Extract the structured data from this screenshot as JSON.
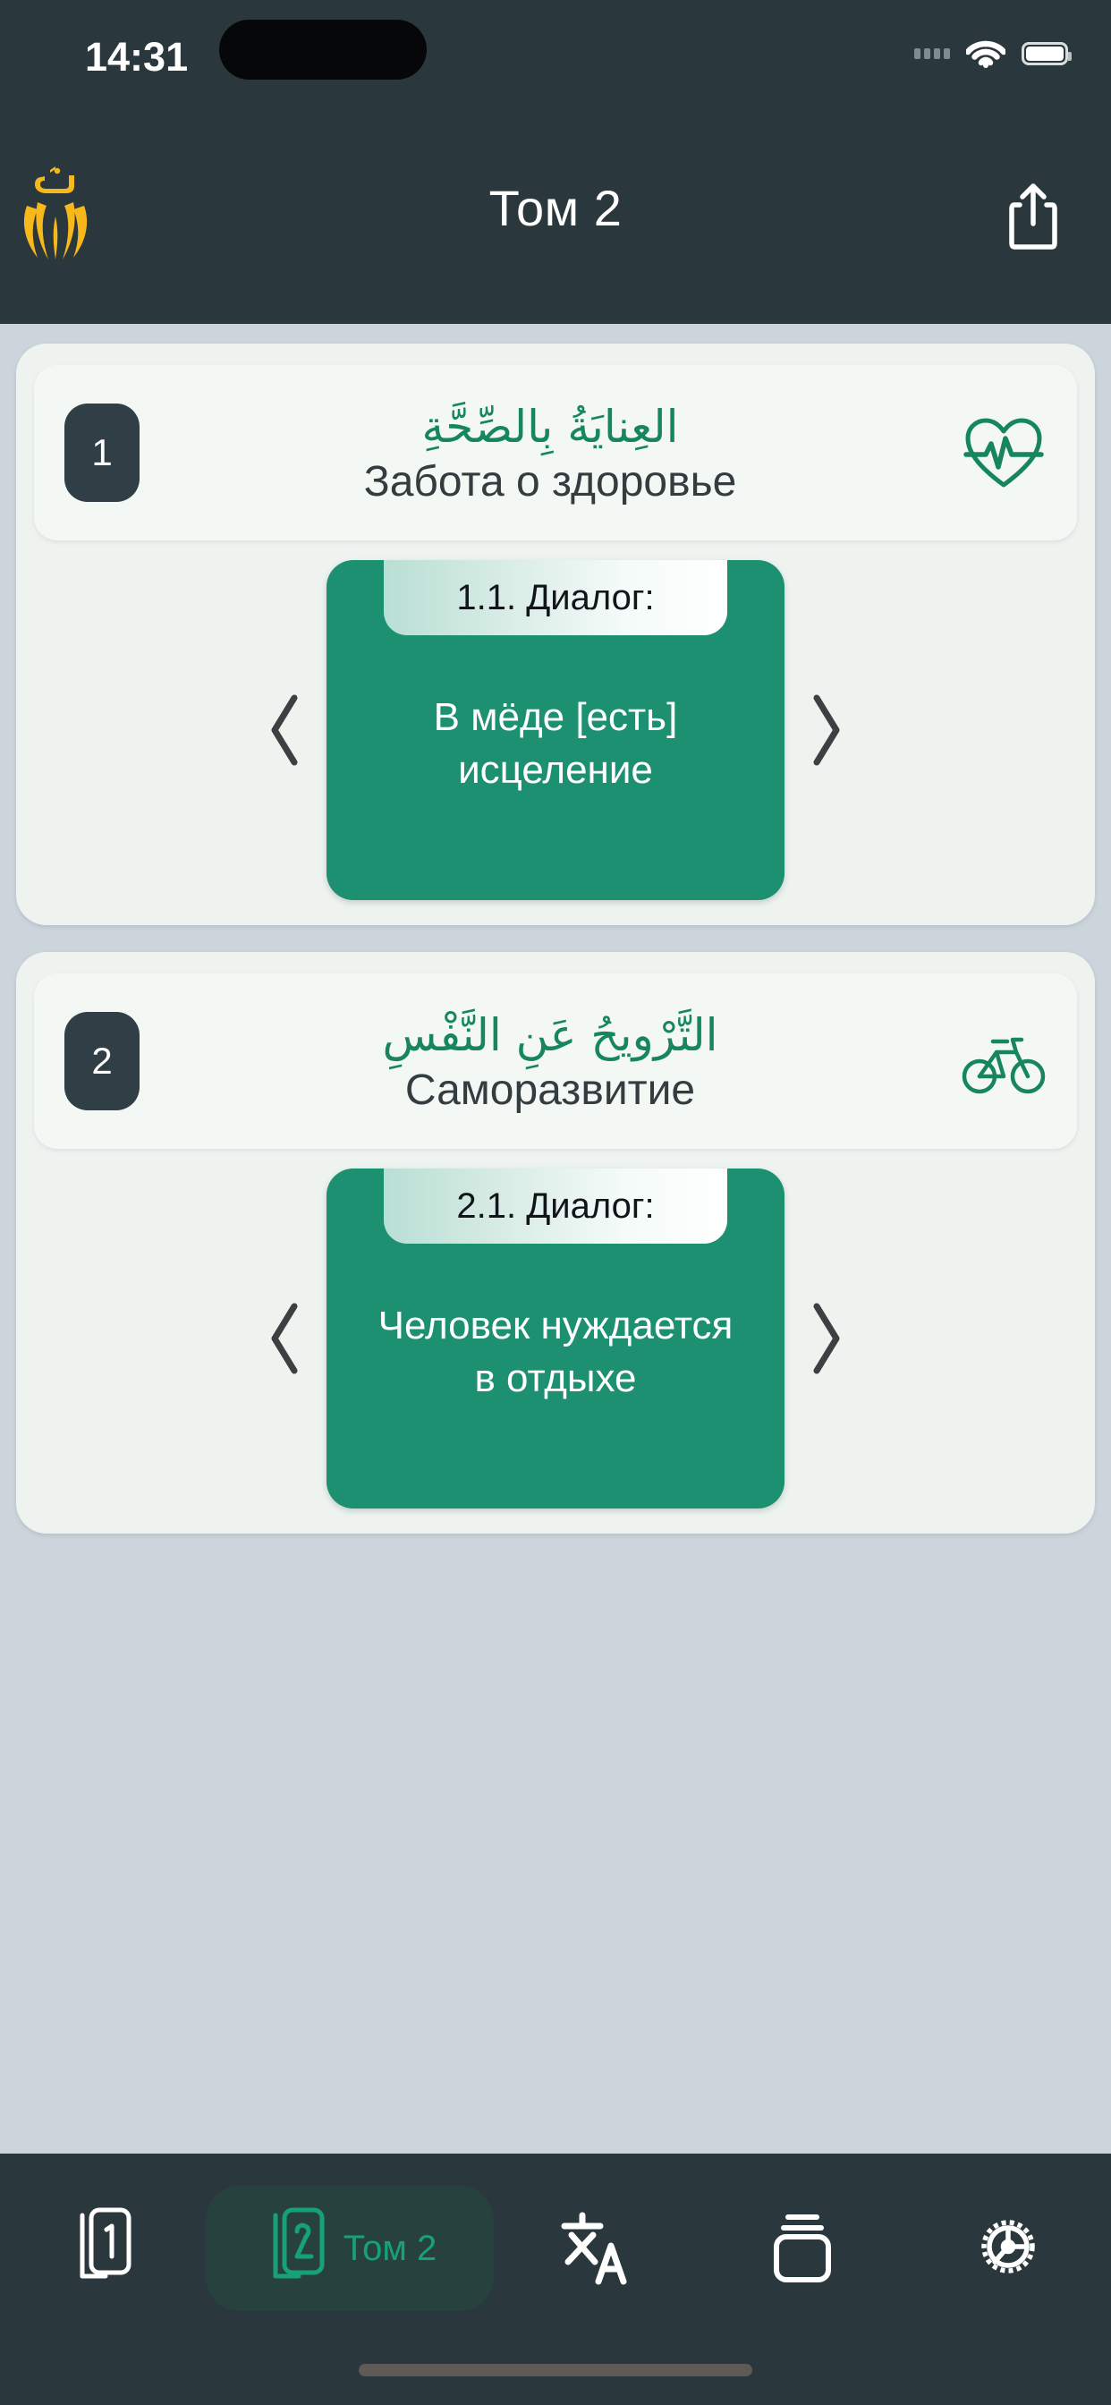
{
  "status_bar": {
    "time": "14:31",
    "cellular_icon": "cellular-dots-icon",
    "wifi_icon": "wifi-icon",
    "battery_icon": "battery-full-icon"
  },
  "header": {
    "logo_icon": "app-logo-hands-daad-icon",
    "title": "Том 2",
    "share_icon": "share-icon"
  },
  "colors": {
    "header_bg": "#2a383d",
    "page_bg": "#ccd4dc",
    "section_bg": "#eef3f0",
    "section_head_bg": "#f4f8f5",
    "green_accent": "#1c9070",
    "arabic_green": "#17865e",
    "badge_bg": "#2f3f45",
    "tab_active_green": "#17a178",
    "logo_gold": "#f7b81c"
  },
  "sections": [
    {
      "number": "1",
      "title_ar": "العِنايَةُ بِالصِّحَّةِ",
      "title_ru": "Забота о здоровье",
      "icon": "heart-pulse-icon",
      "carousel": {
        "prev_icon": "chevron-left-icon",
        "next_icon": "chevron-right-icon",
        "card": {
          "tab_label": "1.1. Диалог:",
          "text": "В мёде [есть] исцеление"
        }
      }
    },
    {
      "number": "2",
      "title_ar": "التَّرْويحُ عَنِ النَّفْسِ",
      "title_ru": "Саморазвитие",
      "icon": "bicycle-icon",
      "carousel": {
        "prev_icon": "chevron-left-icon",
        "next_icon": "chevron-right-icon",
        "card": {
          "tab_label": "2.1. Диалог:",
          "text": "Человек нуждается в отдыхе"
        }
      }
    }
  ],
  "tab_bar": {
    "items": [
      {
        "icon": "book-volume-1-icon",
        "label": "",
        "active": false
      },
      {
        "icon": "book-volume-2-icon",
        "label": "Том 2",
        "active": true
      },
      {
        "icon": "translate-icon",
        "label": "",
        "active": false
      },
      {
        "icon": "card-stack-icon",
        "label": "",
        "active": false
      },
      {
        "icon": "gear-settings-icon",
        "label": "",
        "active": false
      }
    ]
  }
}
